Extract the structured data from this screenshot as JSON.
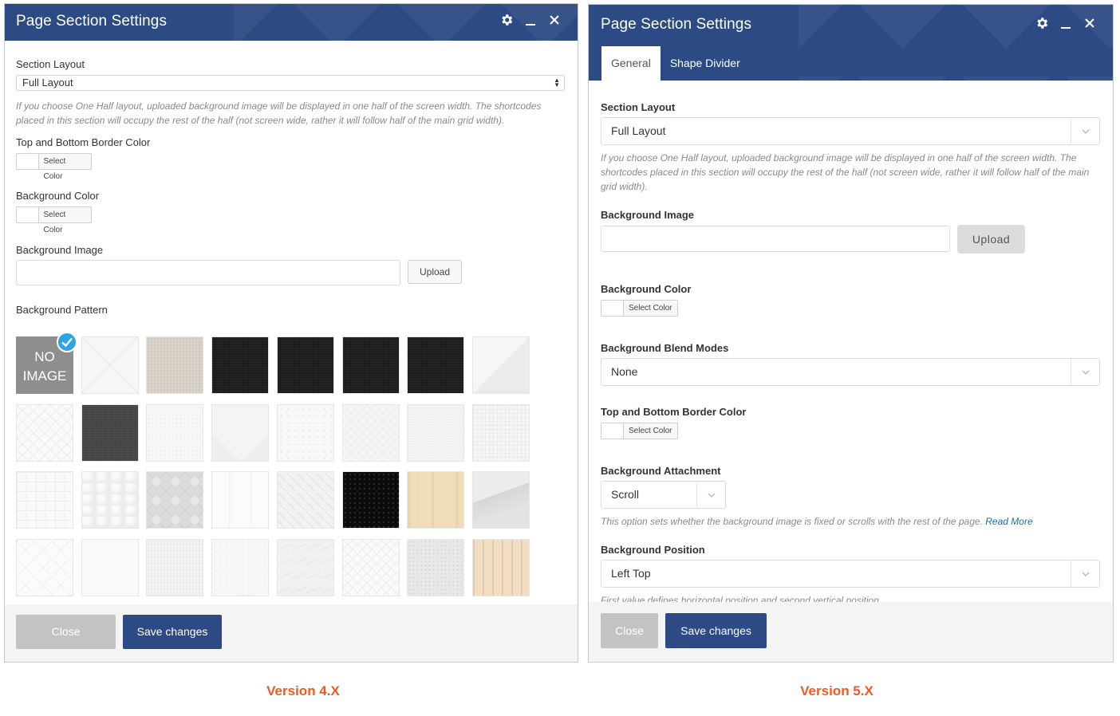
{
  "v4": {
    "title": "Page Section Settings",
    "section_layout_label": "Section Layout",
    "section_layout_value": "Full Layout",
    "layout_help": "If you choose One Half layout, uploaded background image will be displayed in one half of the screen width. The shortcodes placed in this section will occupy the rest of the half (not screen wide, rather it will follow half of the main grid width).",
    "border_color_label": "Top and Bottom Border Color",
    "bg_color_label": "Background Color",
    "select_color": "Select Color",
    "bg_image_label": "Background Image",
    "upload": "Upload",
    "bg_pattern_label": "Background Pattern",
    "no_image_line1": "NO",
    "no_image_line2": "IMAGE",
    "close": "Close",
    "save": "Save changes"
  },
  "v5": {
    "title": "Page Section Settings",
    "tabs": [
      "General",
      "Shape Divider"
    ],
    "section_layout_label": "Section Layout",
    "section_layout_value": "Full Layout",
    "layout_help": "If you choose One Half layout, uploaded background image will be displayed in one half of the screen width. The shortcodes placed in this section will occupy the rest of the half (not screen wide, rather it will follow half of the main grid width).",
    "bg_image_label": "Background Image",
    "upload": "Upload",
    "bg_color_label": "Background Color",
    "select_color": "Select Color",
    "blend_label": "Background Blend Modes",
    "blend_value": "None",
    "border_color_label": "Top and Bottom Border Color",
    "attachment_label": "Background Attachment",
    "attachment_value": "Scroll",
    "attachment_help": "This option sets whether the background image is fixed or scrolls with the rest of the page.",
    "read_more": "Read More",
    "position_label": "Background Position",
    "position_value": "Left Top",
    "position_help": "First value defines horizontal position and second vertical position.",
    "close": "Close",
    "save": "Save changes"
  },
  "captions": {
    "left": "Version 4.X",
    "right": "Version 5.X"
  },
  "colors": {
    "header_blue": "#2c4a84",
    "caption_orange": "#f05a22",
    "check_blue": "#2ea3e6",
    "link_blue": "#1a6fb0"
  },
  "patterns": [
    "no-image",
    "light-diamond",
    "beige-linen",
    "black-fabric",
    "black-fabric",
    "black-fabric",
    "black-fabric",
    "light-gray",
    "white-lattice",
    "dark-gray",
    "white-noise",
    "white-triangles",
    "white-speckle",
    "white-diamond-grid",
    "white-linen",
    "white-grid",
    "white-squares",
    "white-leather",
    "gray-clover",
    "white-stripes",
    "white-maze",
    "black-dots",
    "light-wood",
    "gray-geometric",
    "white-herringbone",
    "white-plain",
    "white-texture",
    "white-paper",
    "white-waves",
    "white-crosshatch",
    "gray-speckle",
    "wood-planks"
  ]
}
